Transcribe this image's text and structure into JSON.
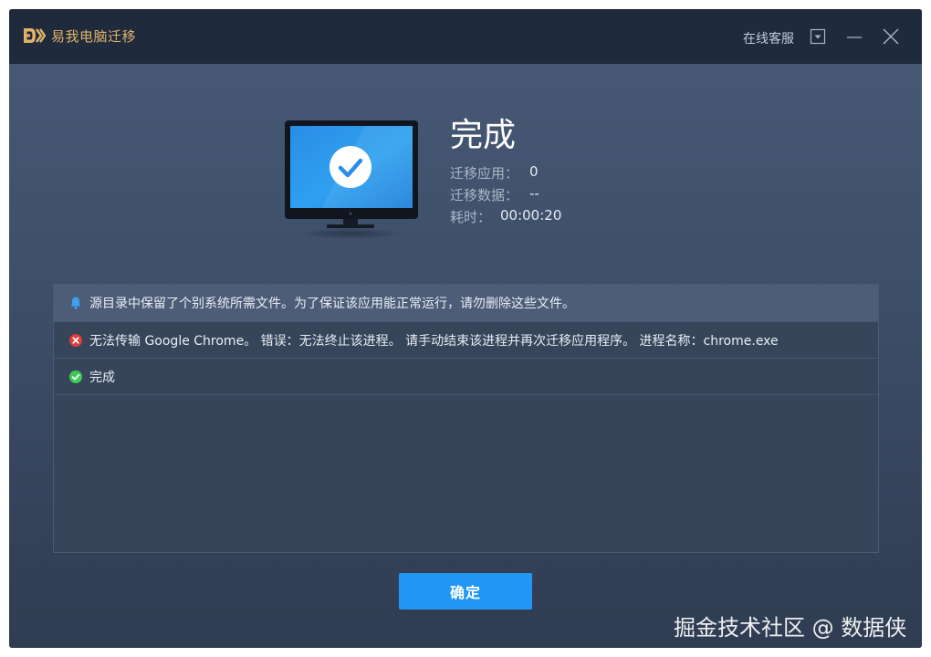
{
  "app": {
    "title": "易我电脑迁移"
  },
  "header": {
    "support_label": "在线客服"
  },
  "result": {
    "title": "完成",
    "stats": [
      {
        "label": "迁移应用：",
        "value": "0"
      },
      {
        "label": "迁移数据：",
        "value": "--"
      },
      {
        "label": "耗时：",
        "value": "00:00:20"
      }
    ]
  },
  "log": [
    {
      "type": "info",
      "icon": "bell-icon",
      "text": "源目录中保留了个别系统所需文件。为了保证该应用能正常运行，请勿删除这些文件。"
    },
    {
      "type": "error",
      "icon": "error-icon",
      "text": "无法传输 Google Chrome。 错误：无法终止该进程。 请手动结束该进程并再次迁移应用程序。 进程名称：chrome.exe"
    },
    {
      "type": "success",
      "icon": "check-circle-icon",
      "text": "完成"
    }
  ],
  "actions": {
    "ok_label": "确定"
  },
  "watermark": "掘金技术社区 @ 数据侠",
  "colors": {
    "titlebar": "#1f2a3c",
    "accent": "#2197f3",
    "brand": "#e0b36a",
    "error": "#e23b3b",
    "success": "#3ecb55",
    "info": "#3aa0f0"
  }
}
